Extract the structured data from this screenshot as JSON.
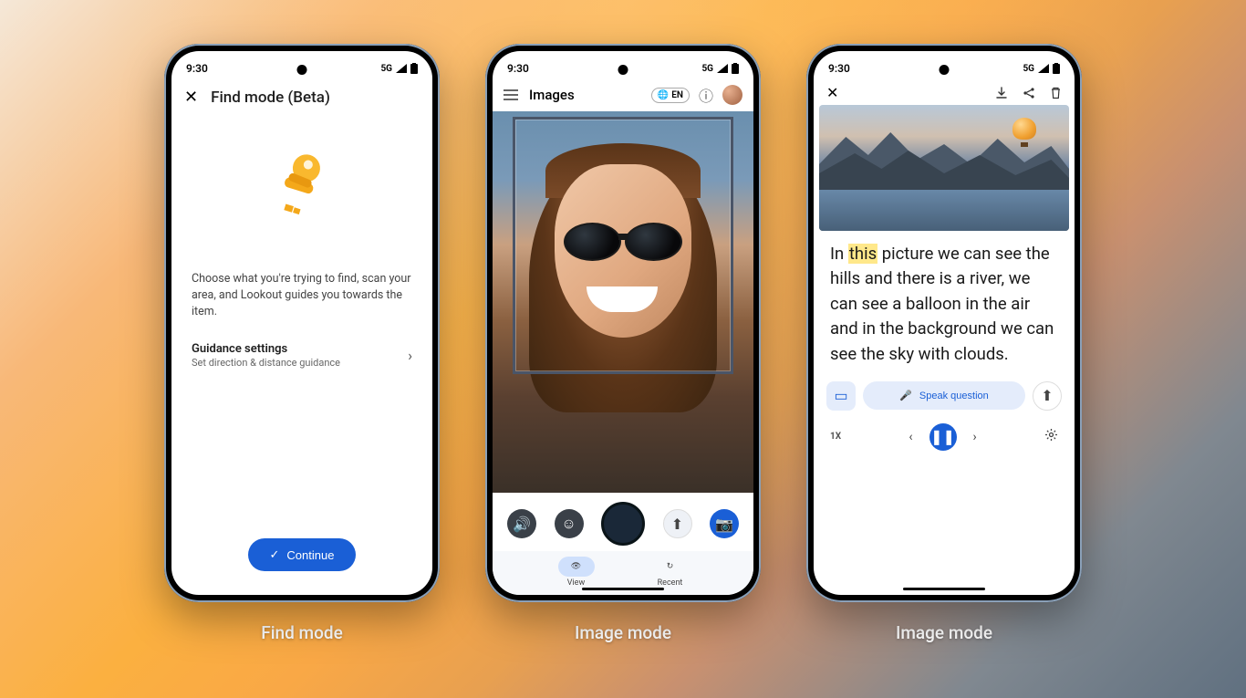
{
  "statusbar": {
    "time": "9:30",
    "network": "5G"
  },
  "captions": {
    "phone1": "Find mode",
    "phone2": "Image mode",
    "phone3": "Image mode"
  },
  "phone1": {
    "title": "Find mode (Beta)",
    "description": "Choose what you're trying to find, scan your area, and Lookout guides you towards the item.",
    "settings_title": "Guidance settings",
    "settings_sub": "Set direction & distance guidance",
    "continue_label": "Continue"
  },
  "phone2": {
    "title": "Images",
    "lang": "EN",
    "tabs": {
      "view": "View",
      "recent": "Recent"
    }
  },
  "phone3": {
    "description_pre": "In ",
    "highlight_word": "this",
    "description_post": " picture we can see the hills and there is a river, we can see a balloon in the air and in the background we can see the sky with clouds.",
    "speak_label": "Speak question",
    "speed": "1X"
  }
}
